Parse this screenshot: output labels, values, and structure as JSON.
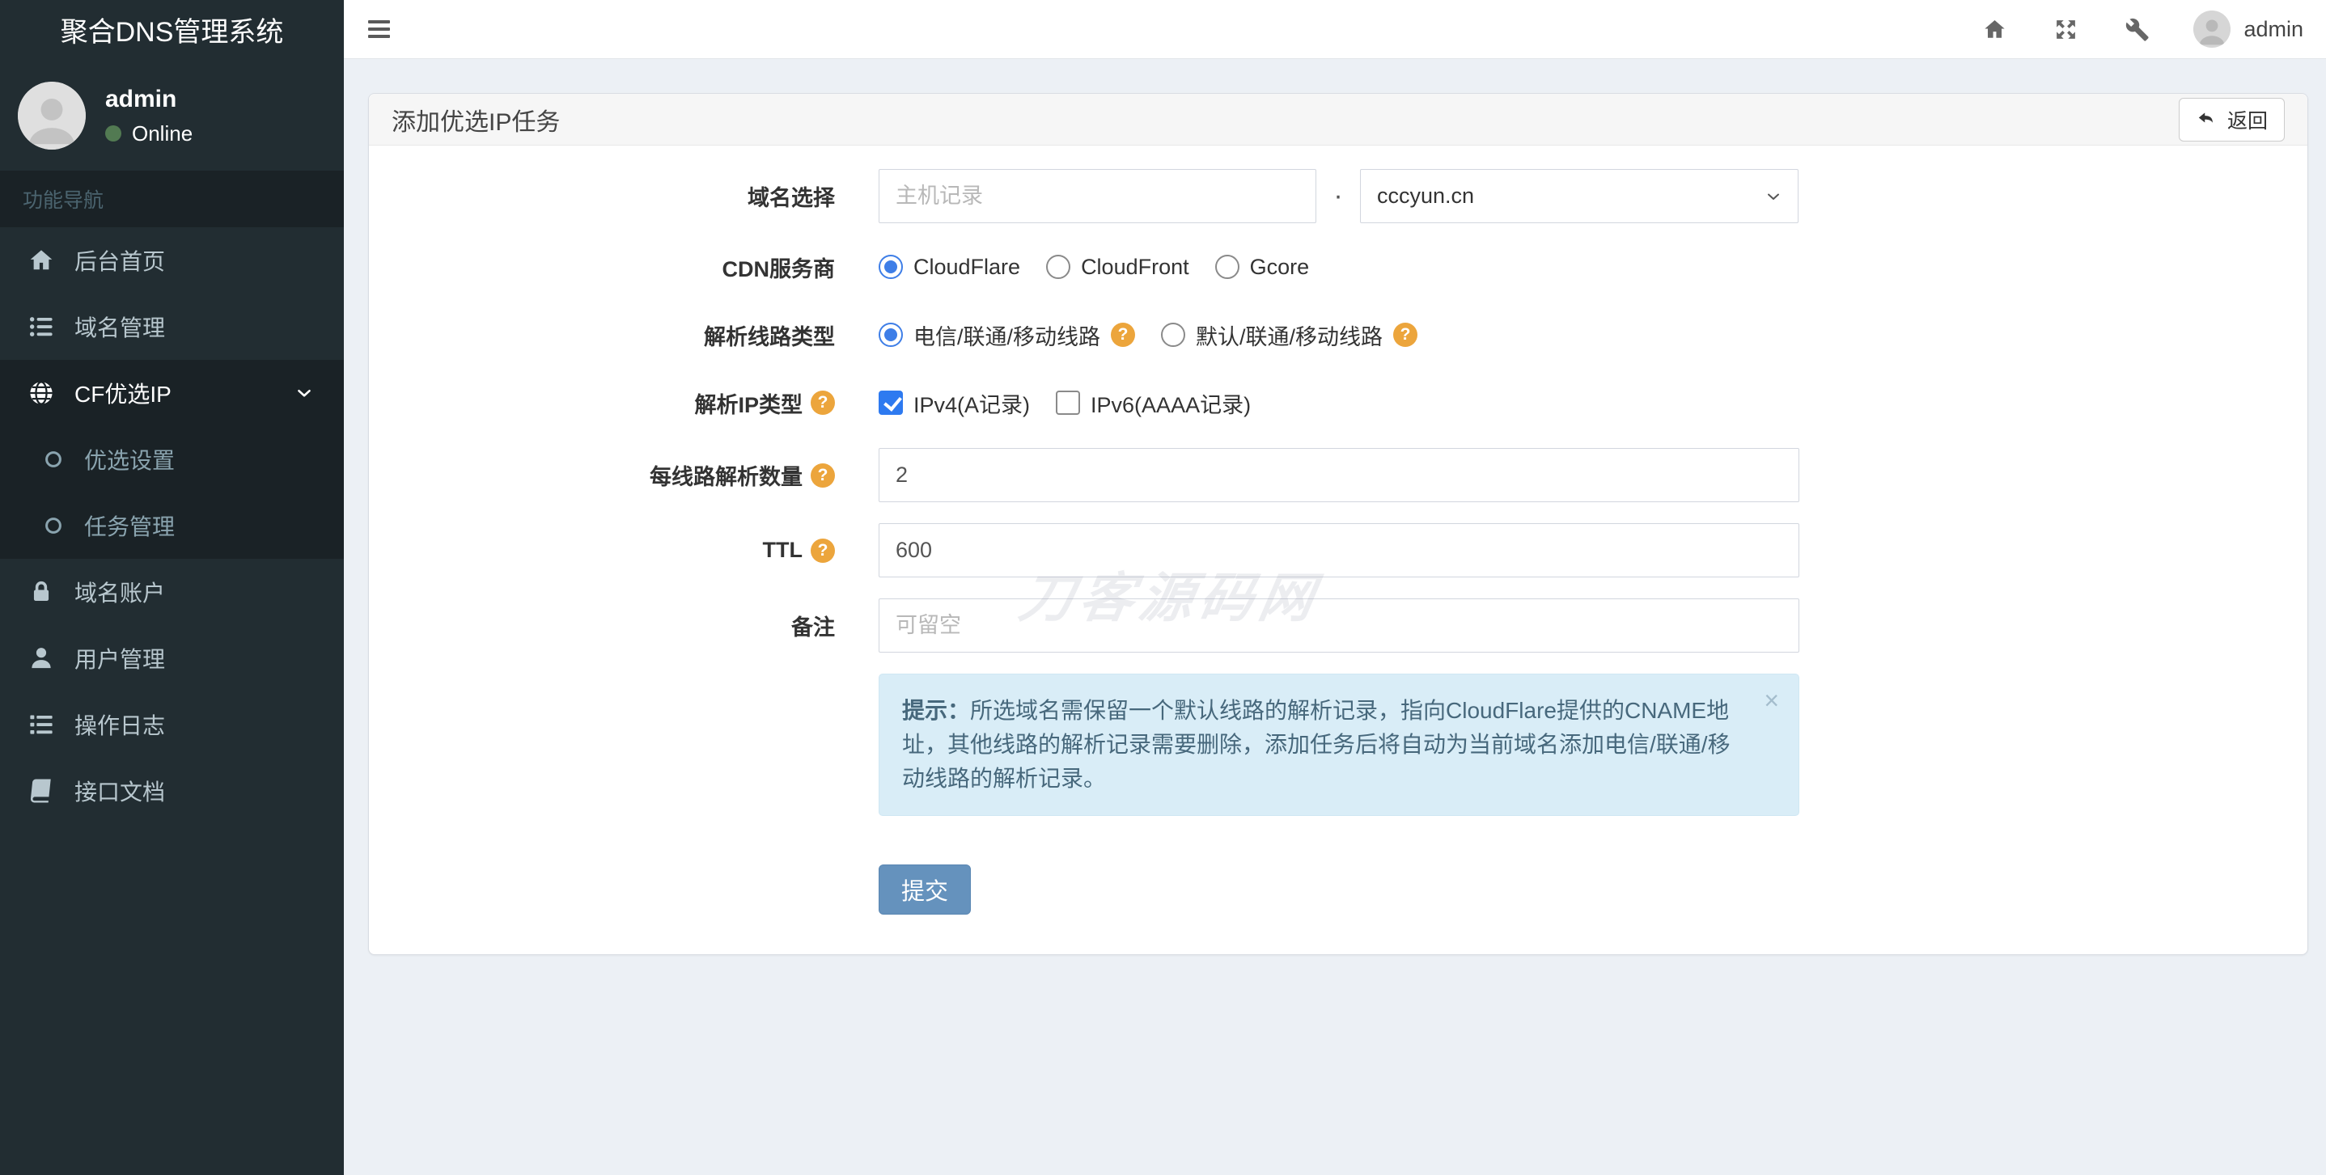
{
  "app": {
    "title": "聚合DNS管理系统"
  },
  "sidebar": {
    "user": {
      "name": "admin",
      "status": "Online"
    },
    "nav_header": "功能导航",
    "items": [
      {
        "label": "后台首页",
        "icon": "home-icon"
      },
      {
        "label": "域名管理",
        "icon": "list-icon"
      },
      {
        "label": "CF优选IP",
        "icon": "globe-icon",
        "active": true,
        "children": [
          {
            "label": "优选设置",
            "icon": "circle-icon"
          },
          {
            "label": "任务管理",
            "icon": "circle-icon"
          }
        ]
      },
      {
        "label": "域名账户",
        "icon": "lock-icon"
      },
      {
        "label": "用户管理",
        "icon": "user-icon"
      },
      {
        "label": "操作日志",
        "icon": "log-list-icon"
      },
      {
        "label": "接口文档",
        "icon": "book-icon"
      }
    ]
  },
  "topbar": {
    "username": "admin",
    "icons": [
      "menu-icon",
      "home-icon",
      "fullscreen-icon",
      "wrench-icon",
      "avatar"
    ]
  },
  "panel": {
    "title": "添加优选IP任务",
    "back_label": "返回"
  },
  "form": {
    "domain": {
      "label": "域名选择",
      "host_placeholder": "主机记录",
      "separator": "·",
      "selected_domain": "cccyun.cn"
    },
    "cdn": {
      "label": "CDN服务商",
      "options": [
        "CloudFlare",
        "CloudFront",
        "Gcore"
      ],
      "selected": "CloudFlare"
    },
    "line_type": {
      "label": "解析线路类型",
      "options": [
        "电信/联通/移动线路",
        "默认/联通/移动线路"
      ],
      "selected": "电信/联通/移动线路"
    },
    "ip_type": {
      "label": "解析IP类型",
      "options": [
        "IPv4(A记录)",
        "IPv6(AAAA记录)"
      ],
      "checked": [
        "IPv4(A记录)"
      ]
    },
    "per_line_count": {
      "label": "每线路解析数量",
      "value": "2"
    },
    "ttl": {
      "label": "TTL",
      "value": "600"
    },
    "remark": {
      "label": "备注",
      "placeholder": "可留空"
    },
    "tip": {
      "bold_prefix": "提示：",
      "text": "所选域名需保留一个默认线路的解析记录，指向CloudFlare提供的CNAME地址，其他线路的解析记录需要删除，添加任务后将自动为当前域名添加电信/联通/移动线路的解析记录。",
      "close_symbol": "×"
    },
    "submit_label": "提交"
  },
  "icons": {
    "help_glyph": "?"
  },
  "watermark": "刀客源码网",
  "colors": {
    "sidebar_bg": "#222d32",
    "sidebar_active_bg": "#1a2226",
    "page_bg": "#ecf0f5",
    "control_blue": "#2e7af0",
    "submit_bg": "#6592bd",
    "alert_bg": "#d9edf7",
    "alert_text": "#47687c",
    "help_icon_bg": "#eca53c",
    "online_green": "#527a52"
  }
}
